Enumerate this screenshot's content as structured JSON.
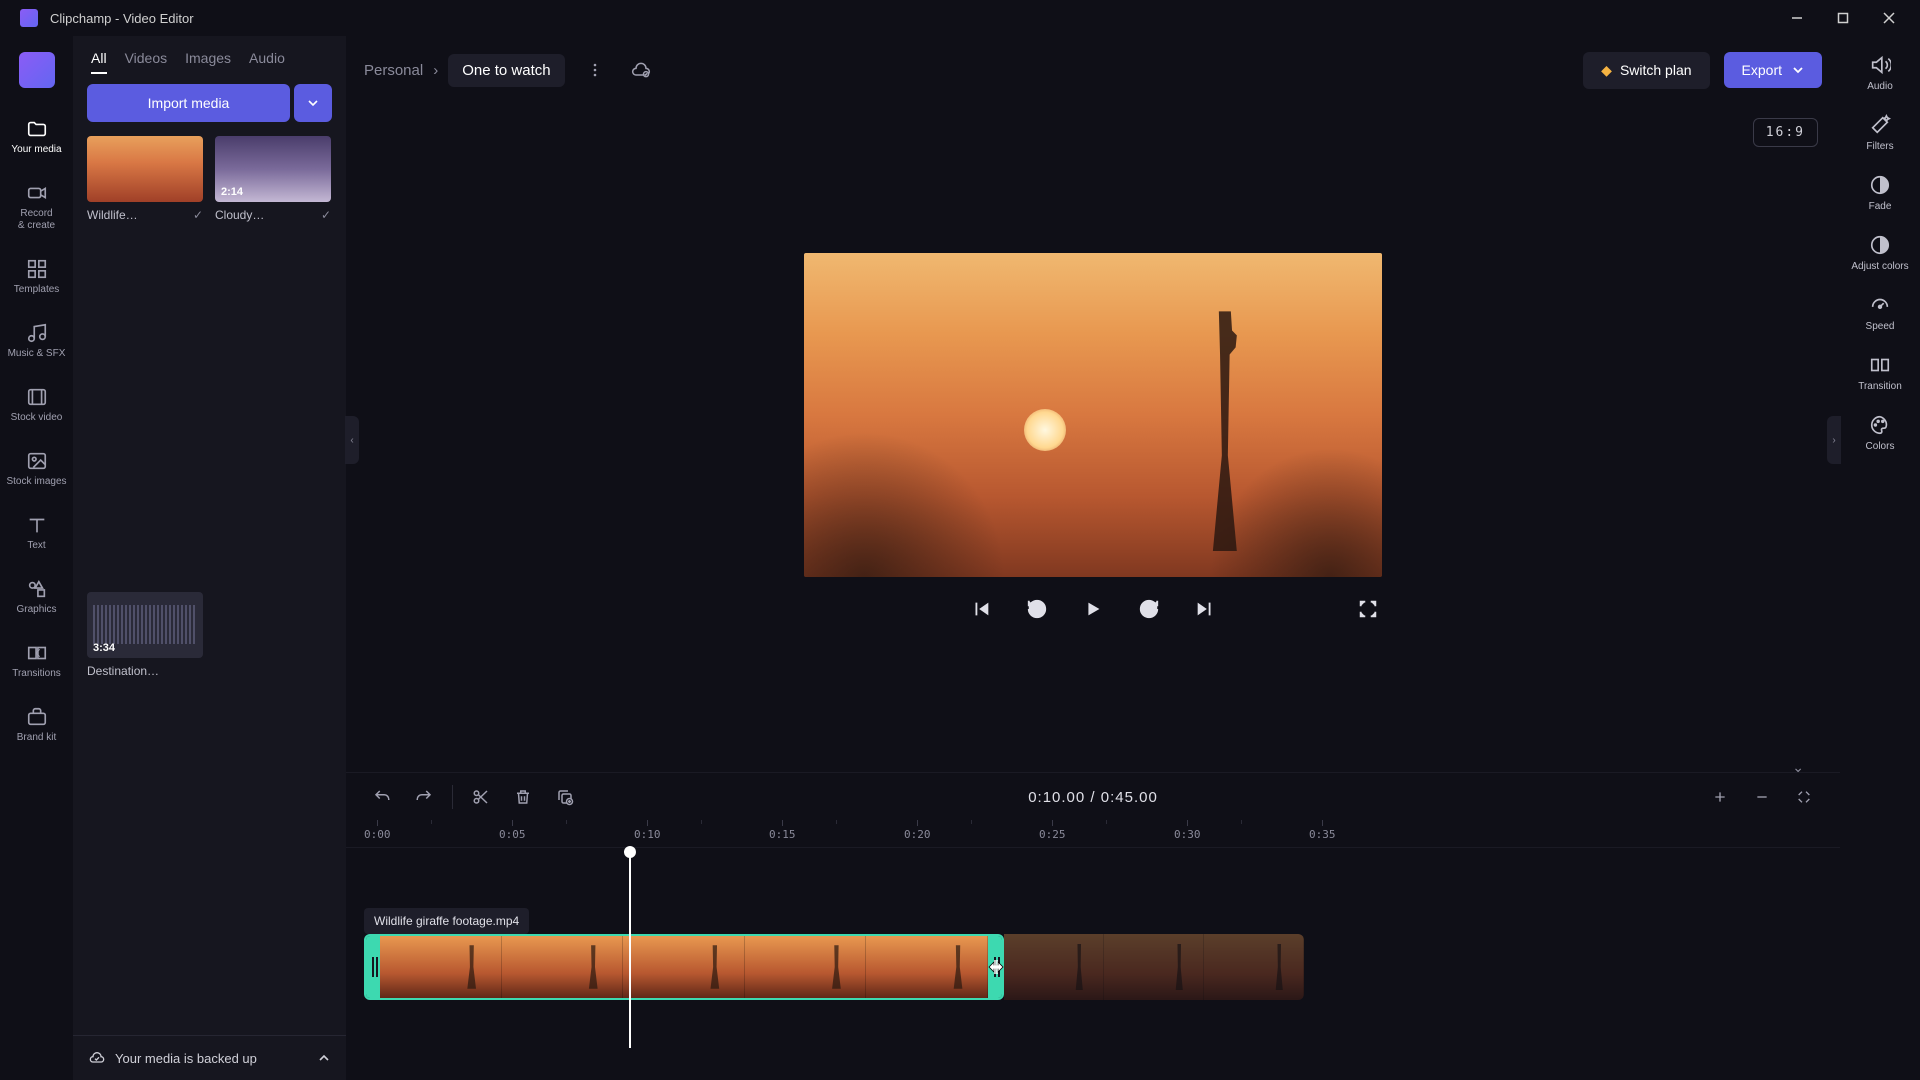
{
  "titlebar": {
    "title": "Clipchamp - Video Editor"
  },
  "rail": {
    "items": [
      {
        "label": "Your media"
      },
      {
        "label": "Record\n& create"
      },
      {
        "label": "Templates"
      },
      {
        "label": "Music & SFX"
      },
      {
        "label": "Stock video"
      },
      {
        "label": "Stock images"
      },
      {
        "label": "Text"
      },
      {
        "label": "Graphics"
      },
      {
        "label": "Transitions"
      },
      {
        "label": "Brand kit"
      }
    ]
  },
  "media_panel": {
    "tabs": [
      "All",
      "Videos",
      "Images",
      "Audio"
    ],
    "import_label": "Import media",
    "items": [
      {
        "name": "Wildlife…",
        "duration": "",
        "checked": true
      },
      {
        "name": "Cloudy…",
        "duration": "2:14",
        "checked": true
      },
      {
        "name": "Destination…",
        "duration": "3:34",
        "checked": false
      }
    ],
    "backup_text": "Your media is backed up"
  },
  "header": {
    "crumb_root": "Personal",
    "project_name": "One to watch",
    "switch_plan": "Switch plan",
    "export": "Export"
  },
  "preview": {
    "aspect": "16:9"
  },
  "timeline": {
    "time_current": "0:10.00",
    "time_sep": " / ",
    "time_total": "0:45.00",
    "ruler": [
      "0:00",
      "0:05",
      "0:10",
      "0:15",
      "0:20",
      "0:25",
      "0:30",
      "0:35"
    ],
    "clip_label": "Wildlife giraffe footage.mp4"
  },
  "props": {
    "items": [
      "Audio",
      "Filters",
      "Fade",
      "Adjust colors",
      "Speed",
      "Transition",
      "Colors"
    ]
  }
}
